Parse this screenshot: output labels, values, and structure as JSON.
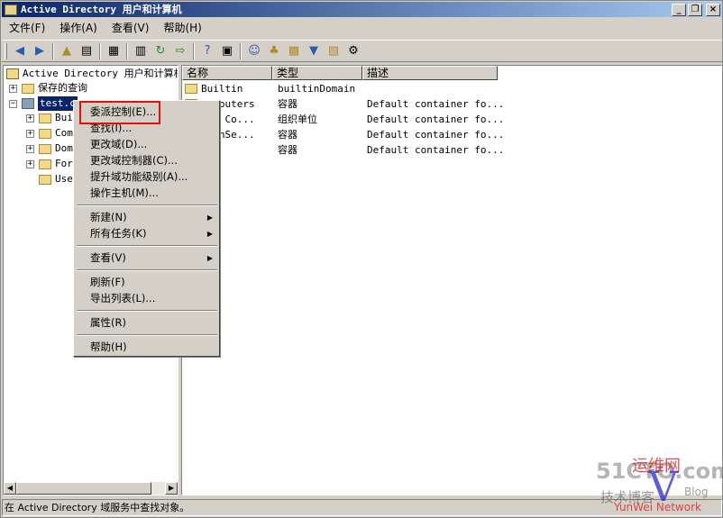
{
  "window": {
    "title": "Active Directory 用户和计算机",
    "minimize": "_",
    "restore": "❐",
    "close": "×"
  },
  "menubar": {
    "items": [
      "文件(F)",
      "操作(A)",
      "查看(V)",
      "帮助(H)"
    ]
  },
  "toolbar": {
    "icons": [
      "back-icon",
      "forward-icon",
      "up-icon",
      "show-tree-icon",
      "copy-icon",
      "properties-icon",
      "refresh-icon",
      "export-icon",
      "help-icon",
      "view-icon",
      "new-user-icon",
      "new-group-icon",
      "new-ou-icon",
      "filter-icon",
      "add-to-group-icon",
      "delegate-icon"
    ]
  },
  "tree": {
    "root": "Active Directory 用户和计算机",
    "saved_queries": "保存的查询",
    "domain": "test.c",
    "children": [
      "Bui",
      "Com",
      "Dom",
      "For",
      "Use"
    ],
    "expander_plus": "+",
    "expander_minus": "−"
  },
  "list": {
    "columns": [
      "名称",
      "类型",
      "描述"
    ],
    "rows": [
      {
        "name": "Builtin",
        "type": "builtinDomain",
        "desc": ""
      },
      {
        "name": "Computers",
        "type": "容器",
        "desc": "Default container fo..."
      },
      {
        "name": "ain Co...",
        "type": "组织单位",
        "desc": "Default container fo..."
      },
      {
        "name": "eignSe...",
        "type": "容器",
        "desc": "Default container fo..."
      },
      {
        "name": "rs",
        "type": "容器",
        "desc": "Default container fo..."
      }
    ]
  },
  "context_menu": {
    "groups": [
      [
        "委派控制(E)...",
        "查找(I)...",
        "更改域(D)...",
        "更改域控制器(C)...",
        "提升域功能级别(A)...",
        "操作主机(M)..."
      ],
      [
        "新建(N)",
        "所有任务(K)"
      ],
      [
        "查看(V)"
      ],
      [
        "刷新(F)",
        "导出列表(L)..."
      ],
      [
        "属性(R)"
      ],
      [
        "帮助(H)"
      ]
    ],
    "submenu_arrow": "▶"
  },
  "statusbar": {
    "text": "在 Active Directory 域服务中查找对象。"
  },
  "watermark": {
    "site": "51CTO.com",
    "red_text": "运维网",
    "sub": "技术博客",
    "blog": "Blog",
    "v": "V",
    "yn": "YunWei Network"
  },
  "scrollbar": {
    "left": "◀",
    "right": "▶"
  },
  "colors": {
    "titlebar_start": "#0a246a",
    "titlebar_end": "#a6caf0",
    "selection": "#0a246a",
    "highlight_box": "#e01010",
    "chrome": "#d4d0c8"
  }
}
